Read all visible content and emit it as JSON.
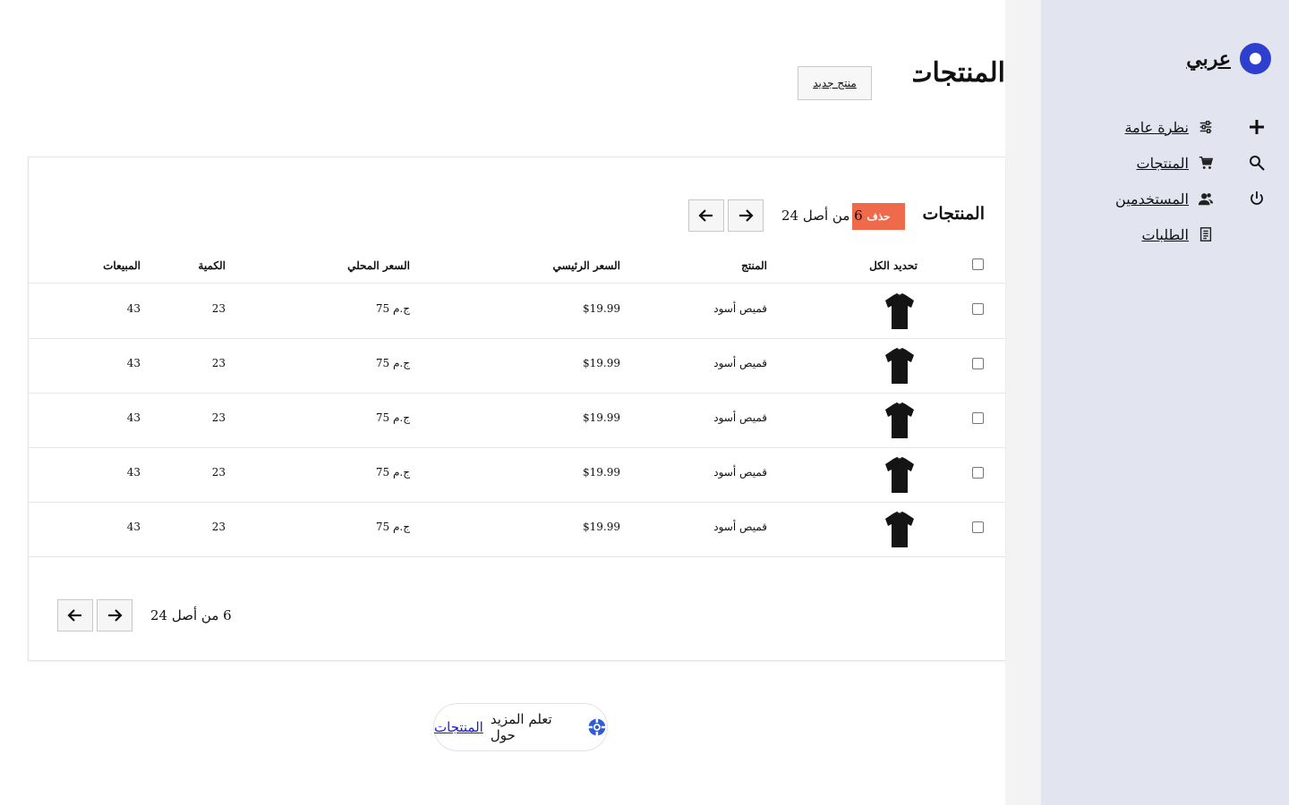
{
  "sidebar": {
    "brand": "عربي",
    "nav": [
      {
        "label": "نظرة عامة",
        "icon": "sliders-icon"
      },
      {
        "label": "المنتجات",
        "icon": "cart-icon"
      },
      {
        "label": "المستخدمين",
        "icon": "users-icon"
      },
      {
        "label": "الطلبات",
        "icon": "document-icon"
      }
    ],
    "quick": [
      {
        "icon": "plus-icon"
      },
      {
        "icon": "search-icon"
      },
      {
        "icon": "power-icon"
      }
    ]
  },
  "header": {
    "title": "المنتجات",
    "new_button": "منتج جديد"
  },
  "card": {
    "title": "المنتجات",
    "delete": "حذف",
    "count_top": "6 من أصل 24",
    "count_bottom": "6 من أصل 24"
  },
  "table": {
    "select_all": "تحديد الكل",
    "columns": [
      "المنتج",
      "السعر الرئيسي",
      "السعر المحلي",
      "الكمية",
      "المبيعات"
    ],
    "rows": [
      {
        "product": "قميص أسود",
        "main_price": "$19.99",
        "local_price": "75 ج.م",
        "quantity": "23",
        "sales": "43"
      },
      {
        "product": "قميص أسود",
        "main_price": "$19.99",
        "local_price": "75 ج.م",
        "quantity": "23",
        "sales": "43"
      },
      {
        "product": "قميص أسود",
        "main_price": "$19.99",
        "local_price": "75 ج.م",
        "quantity": "23",
        "sales": "43"
      },
      {
        "product": "قميص أسود",
        "main_price": "$19.99",
        "local_price": "75 ج.م",
        "quantity": "23",
        "sales": "43"
      },
      {
        "product": "قميص أسود",
        "main_price": "$19.99",
        "local_price": "75 ج.م",
        "quantity": "23",
        "sales": "43"
      }
    ]
  },
  "footer": {
    "text": "تعلم المزيد حول",
    "link": "المنتجات",
    "icon": "lifebuoy-icon"
  },
  "colors": {
    "sidebar_bg": "#e2e4ef",
    "brand": "#2e3fd0",
    "delete": "#ee6a4b"
  }
}
